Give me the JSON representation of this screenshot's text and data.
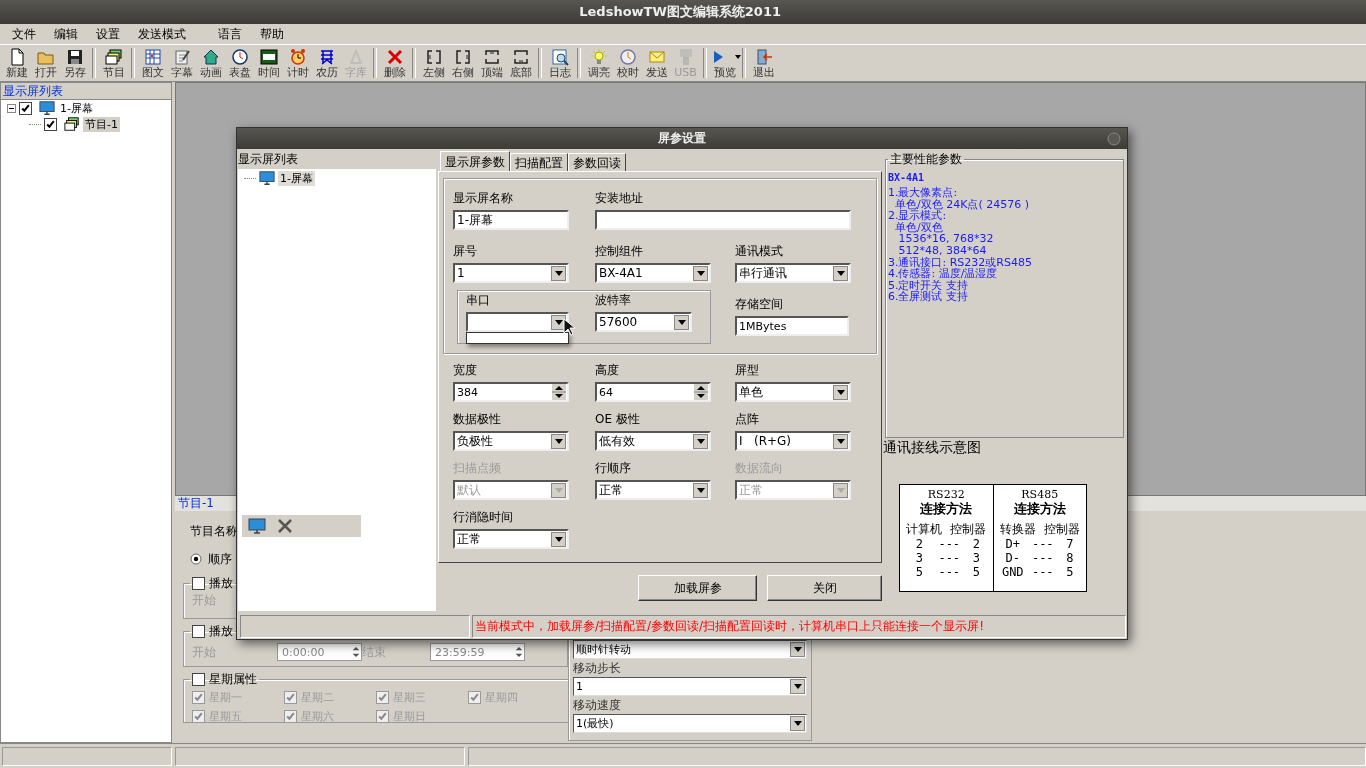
{
  "window": {
    "title": "LedshowTW图文编辑系统2011"
  },
  "menu": [
    "文件",
    "编辑",
    "设置",
    "发送模式",
    "语言",
    "帮助"
  ],
  "toolbar": [
    [
      {
        "label": "新建",
        "disabled": false,
        "dropdown": false
      },
      {
        "label": "打开",
        "disabled": false,
        "dropdown": false
      },
      {
        "label": "另存",
        "disabled": false,
        "dropdown": false
      }
    ],
    [
      {
        "label": "节目",
        "disabled": false,
        "dropdown": false
      }
    ],
    [
      {
        "label": "图文",
        "disabled": false,
        "dropdown": false
      },
      {
        "label": "字幕",
        "disabled": false,
        "dropdown": false
      },
      {
        "label": "动画",
        "disabled": false,
        "dropdown": false
      },
      {
        "label": "表盘",
        "disabled": false,
        "dropdown": false
      },
      {
        "label": "时间",
        "disabled": false,
        "dropdown": false
      },
      {
        "label": "计时",
        "disabled": false,
        "dropdown": false
      },
      {
        "label": "农历",
        "disabled": false,
        "dropdown": false
      },
      {
        "label": "字库",
        "disabled": true,
        "dropdown": false
      }
    ],
    [
      {
        "label": "删除",
        "disabled": false,
        "dropdown": false
      }
    ],
    [
      {
        "label": "左侧",
        "disabled": false,
        "dropdown": false
      },
      {
        "label": "右侧",
        "disabled": false,
        "dropdown": false
      },
      {
        "label": "顶端",
        "disabled": false,
        "dropdown": false
      },
      {
        "label": "底部",
        "disabled": false,
        "dropdown": false
      }
    ],
    [
      {
        "label": "日志",
        "disabled": false,
        "dropdown": false
      }
    ],
    [
      {
        "label": "调亮",
        "disabled": false,
        "dropdown": false
      },
      {
        "label": "校时",
        "disabled": false,
        "dropdown": false
      },
      {
        "label": "发送",
        "disabled": false,
        "dropdown": false
      },
      {
        "label": "USB",
        "disabled": true,
        "dropdown": false
      }
    ],
    [
      {
        "label": "预览",
        "disabled": false,
        "dropdown": true
      }
    ],
    [
      {
        "label": "退出",
        "disabled": false,
        "dropdown": false
      }
    ]
  ],
  "sidebar": {
    "title": "显示屏列表",
    "tree": [
      {
        "label": "1-屏幕",
        "checked": true,
        "expanded": true,
        "selected": false,
        "children": [
          {
            "label": "节目-1",
            "checked": true,
            "selected": true
          }
        ]
      }
    ]
  },
  "program_panel": {
    "title": "节目-1",
    "name_label": "节目名称",
    "order_radio": {
      "label": "顺序",
      "selected": true
    },
    "play_time_1": {
      "label": "播放",
      "checked": false,
      "start_label": "开始"
    },
    "play_time_2": {
      "label": "播放",
      "checked": false,
      "start_label": "开始",
      "start": "0:00:00",
      "end_label": "结束",
      "end": "23:59:59"
    },
    "weekdays": {
      "label": "星期属性",
      "checked": false,
      "disabled": true,
      "days": [
        {
          "label": "星期一",
          "checked": true
        },
        {
          "label": "星期二",
          "checked": true
        },
        {
          "label": "星期三",
          "checked": true
        },
        {
          "label": "星期四",
          "checked": true
        },
        {
          "label": "星期五",
          "checked": true
        },
        {
          "label": "星期六",
          "checked": true
        },
        {
          "label": "星期日",
          "checked": true
        }
      ]
    },
    "motion": {
      "effect": "顺时针转动",
      "step_label": "移动步长",
      "step": "1",
      "speed_label": "移动速度",
      "speed": "1(最快)"
    }
  },
  "dialog": {
    "title": "屏参设置",
    "left_panel": {
      "title": "显示屏列表",
      "tree": [
        {
          "label": "1-屏幕",
          "selected": true
        }
      ]
    },
    "tabs": [
      {
        "label": "显示屏参数",
        "selected": true
      },
      {
        "label": "扫描配置",
        "selected": false
      },
      {
        "label": "参数回读",
        "selected": false
      }
    ],
    "group_rows": [
      [
        {
          "kind": "text",
          "label": "显示屏名称",
          "value": "1-屏幕"
        },
        {
          "kind": "text",
          "label": "安装地址"
        }
      ],
      [
        {
          "kind": "combo",
          "label": "屏号",
          "value": "1",
          "disabled": false,
          "open": false
        },
        {
          "kind": "combo",
          "label": "控制组件",
          "value": "BX-4A1",
          "disabled": false,
          "open": false
        },
        {
          "kind": "combo",
          "label": "通讯模式",
          "value": "串行通讯",
          "disabled": false,
          "open": false
        }
      ]
    ],
    "port_box": [
      {
        "kind": "combo",
        "label": "串口",
        "disabled": false,
        "open": true
      },
      {
        "kind": "combo",
        "label": "波特率",
        "value": "57600",
        "disabled": false,
        "open": false
      }
    ],
    "storage": {
      "kind": "text",
      "label": "存储空间",
      "value": "1MBytes"
    },
    "rows": [
      [
        {
          "kind": "spin",
          "label": "宽度",
          "value": "384",
          "disabled": false
        },
        {
          "kind": "spin",
          "label": "高度",
          "value": "64",
          "disabled": false
        },
        {
          "kind": "combo",
          "label": "屏型",
          "value": "单色",
          "disabled": false,
          "open": false
        }
      ],
      [
        {
          "kind": "combo",
          "label": "数据极性",
          "value": "负极性",
          "disabled": false,
          "open": false
        },
        {
          "kind": "combo",
          "label": "OE 极性",
          "value": "低有效",
          "disabled": false,
          "open": false
        },
        {
          "kind": "combo",
          "label": "点阵",
          "value": "I   (R+G)",
          "disabled": false,
          "open": false
        }
      ],
      [
        {
          "kind": "combo",
          "label": "扫描点频",
          "value": "默认",
          "disabled": true,
          "open": false
        },
        {
          "kind": "combo",
          "label": "行顺序",
          "value": "正常",
          "disabled": false,
          "open": false
        },
        {
          "kind": "combo",
          "label": "数据流向",
          "value": "正常",
          "disabled": true,
          "open": false
        }
      ],
      [
        {
          "kind": "combo",
          "label": "行消隐时间",
          "value": "正常",
          "disabled": false,
          "open": false
        }
      ]
    ],
    "buttons": [
      "加载屏参",
      "关闭"
    ],
    "status": "当前模式中，加载屏参/扫描配置/参数回读/扫描配置回读时，计算机串口上只能连接一个显示屏!",
    "specs": {
      "title": "主要性能参数",
      "model": "BX-4A1",
      "lines": [
        "1.最大像素点:",
        "  单色/双色 24K点( 24576 )",
        "2.显示模式:",
        "  单色/双色",
        "   1536*16, 768*32",
        "   512*48, 384*64",
        "3.通讯接口: RS232或RS485",
        "4.传感器: 温度/温湿度",
        "5.定时开关 支持",
        "6.全屏测试 支持"
      ]
    },
    "wiring": {
      "title": "通讯接线示意图",
      "columns": [
        {
          "name": "RS232",
          "method": "连接方法",
          "headers": [
            "计算机",
            "控制器"
          ],
          "rows": [
            [
              "2",
              "---",
              "2"
            ],
            [
              "3",
              "---",
              "3"
            ],
            [
              "5",
              "---",
              "5"
            ]
          ]
        },
        {
          "name": "RS485",
          "method": "连接方法",
          "headers": [
            "转换器",
            "控制器"
          ],
          "rows": [
            [
              "D+",
              "---",
              "7"
            ],
            [
              "D-",
              "---",
              "8"
            ],
            [
              "GND",
              "---",
              "5"
            ]
          ]
        }
      ]
    }
  }
}
